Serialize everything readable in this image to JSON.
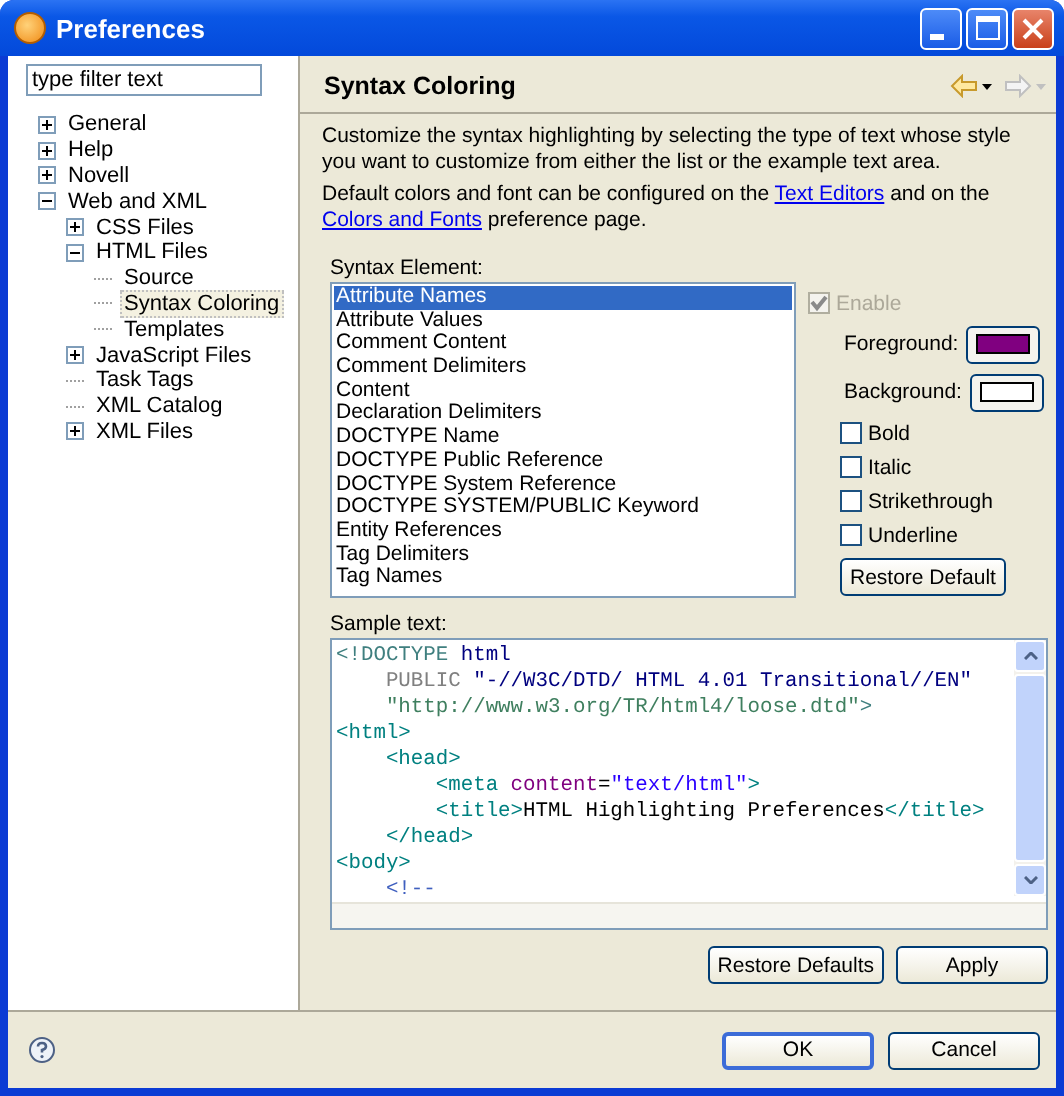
{
  "window": {
    "title": "Preferences"
  },
  "filter": {
    "placeholder": "type filter text"
  },
  "tree": [
    {
      "label": "General",
      "expanded": false,
      "selected": false
    },
    {
      "label": "Help",
      "expanded": false,
      "selected": false
    },
    {
      "label": "Novell",
      "expanded": false,
      "selected": false
    },
    {
      "label": "Web and XML",
      "expanded": true,
      "selected": false,
      "children": [
        {
          "label": "CSS Files",
          "expanded": false,
          "selected": false
        },
        {
          "label": "HTML Files",
          "expanded": true,
          "selected": false,
          "children": [
            {
              "label": "Source",
              "selected": false
            },
            {
              "label": "Syntax Coloring",
              "selected": true
            },
            {
              "label": "Templates",
              "selected": false
            }
          ]
        },
        {
          "label": "JavaScript Files",
          "expanded": false,
          "selected": false
        },
        {
          "label": "Task Tags",
          "selected": false
        },
        {
          "label": "XML Catalog",
          "selected": false
        },
        {
          "label": "XML Files",
          "expanded": false,
          "selected": false
        }
      ]
    }
  ],
  "page": {
    "title": "Syntax Coloring",
    "description": [
      [
        {
          "text": "Customize the syntax highlighting by selecting the type of text whose style you want to customize from either the list or the example text area."
        }
      ],
      [
        {
          "text": "Default colors and font can be configured on the "
        },
        {
          "link": "Text Editors"
        },
        {
          "text": " and on the "
        },
        {
          "link": "Colors and Fonts"
        },
        {
          "text": " preference page."
        }
      ]
    ],
    "syntax_label": "Syntax Element:",
    "elements": [
      {
        "label": "Attribute Names",
        "selected": true
      },
      {
        "label": "Attribute Values",
        "selected": false
      },
      {
        "label": "Comment Content",
        "selected": false
      },
      {
        "label": "Comment Delimiters",
        "selected": false
      },
      {
        "label": "Content",
        "selected": false
      },
      {
        "label": "Declaration Delimiters",
        "selected": false
      },
      {
        "label": "DOCTYPE Name",
        "selected": false
      },
      {
        "label": "DOCTYPE Public Reference",
        "selected": false
      },
      {
        "label": "DOCTYPE System Reference",
        "selected": false
      },
      {
        "label": "DOCTYPE SYSTEM/PUBLIC Keyword",
        "selected": false
      },
      {
        "label": "Entity References",
        "selected": false
      },
      {
        "label": "Tag Delimiters",
        "selected": false
      },
      {
        "label": "Tag Names",
        "selected": false
      }
    ],
    "enable": {
      "label": "Enable",
      "checked": true,
      "disabled": true
    },
    "foreground": {
      "label": "Foreground:",
      "color": "#800080"
    },
    "background": {
      "label": "Background:",
      "color": "#ffffff"
    },
    "styles": [
      {
        "label": "Bold",
        "checked": false
      },
      {
        "label": "Italic",
        "checked": false
      },
      {
        "label": "Strikethrough",
        "checked": false
      },
      {
        "label": "Underline",
        "checked": false
      }
    ],
    "restore_default": "Restore Default",
    "sample_label": "Sample text:",
    "sample": [
      [
        {
          "kind": "delimiter",
          "text": "<!DOCTYPE "
        },
        {
          "kind": "doctype-name",
          "text": "html"
        }
      ],
      [
        {
          "kind": "keyword",
          "text": "    PUBLIC "
        },
        {
          "kind": "public-ref",
          "text": "\"-//W3C/DTD/ HTML 4.01 Transitional//EN\""
        }
      ],
      [
        {
          "kind": "system-ref",
          "text": "    \"http://www.w3.org/TR/html4/loose.dtd\""
        },
        {
          "kind": "delimiter",
          "text": ">"
        }
      ],
      [
        {
          "kind": "tag",
          "text": "<html>"
        }
      ],
      [
        {
          "kind": "tag",
          "text": "    <head>"
        }
      ],
      [
        {
          "kind": "tag",
          "text": "        <meta "
        },
        {
          "kind": "attr",
          "text": "content"
        },
        {
          "kind": "text",
          "text": "="
        },
        {
          "kind": "value",
          "text": "\"text/html\""
        },
        {
          "kind": "tag",
          "text": ">"
        }
      ],
      [
        {
          "kind": "tag",
          "text": "        <title>"
        },
        {
          "kind": "text",
          "text": "HTML Highlighting Preferences"
        },
        {
          "kind": "tag",
          "text": "</title>"
        }
      ],
      [
        {
          "kind": "tag",
          "text": "    </head>"
        }
      ],
      [
        {
          "kind": "tag",
          "text": "<body>"
        }
      ],
      [
        {
          "kind": "comment",
          "text": "    <!--"
        }
      ]
    ],
    "restore_defaults": "Restore Defaults",
    "apply": "Apply"
  },
  "buttons": [
    "OK",
    "Cancel"
  ]
}
